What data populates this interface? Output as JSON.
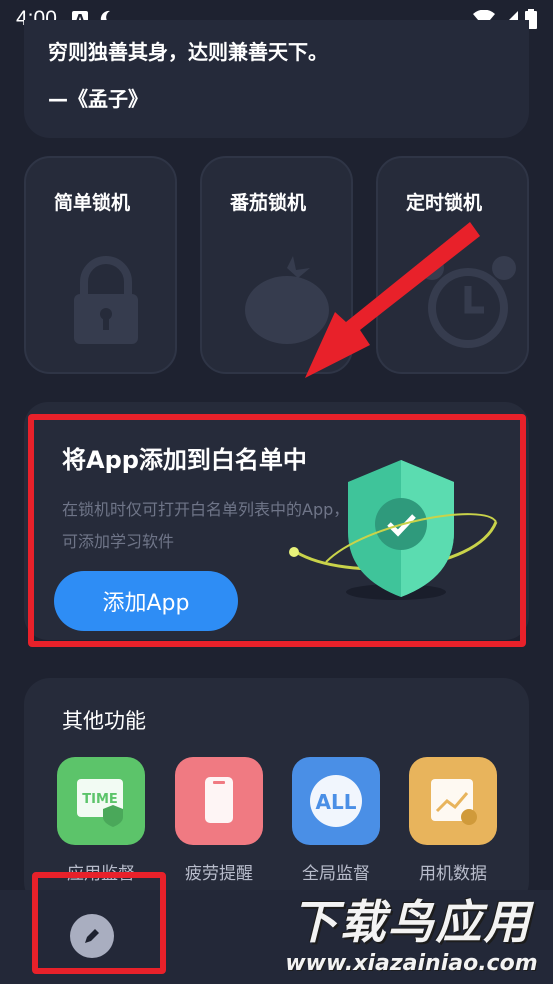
{
  "status_bar": {
    "time": "4:00"
  },
  "quote": {
    "text": "穷则独善其身，达则兼善天下。",
    "author": "—《孟子》"
  },
  "lock_modes": [
    {
      "label": "简单锁机",
      "icon": "padlock-icon"
    },
    {
      "label": "番茄锁机",
      "icon": "tomato-icon"
    },
    {
      "label": "定时锁机",
      "icon": "alarm-clock-icon"
    }
  ],
  "whitelist": {
    "title": "将App添加到白名单中",
    "description": "在锁机时仅可打开白名单列表中的App，可添加学习软件",
    "button_label": "添加App"
  },
  "other_features": {
    "title": "其他功能",
    "items": [
      {
        "label": "应用监督",
        "tile_text": "TIME",
        "color": "#5cc46a"
      },
      {
        "label": "疲劳提醒",
        "tile_text": "",
        "color": "#f07a82"
      },
      {
        "label": "全局监督",
        "tile_text": "ALL",
        "color": "#4a8fe6"
      },
      {
        "label": "用机数据",
        "tile_text": "",
        "color": "#e8b45c"
      }
    ]
  },
  "watermark": {
    "big": "下载鸟应用",
    "small": "www.xiazainiao.com"
  },
  "colors": {
    "accent": "#2e8df5",
    "highlight": "#e8212a",
    "background": "#1e2230"
  }
}
